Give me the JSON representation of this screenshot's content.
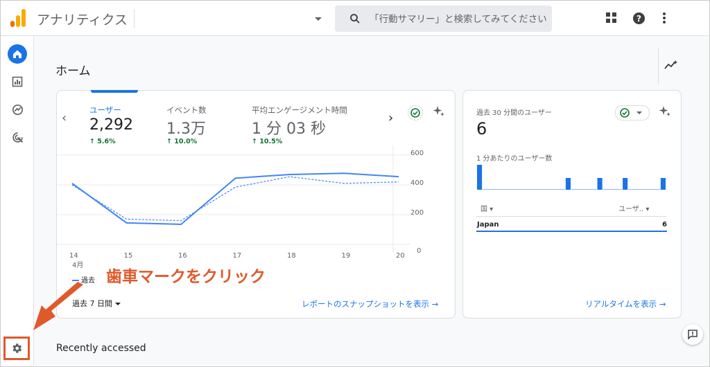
{
  "app": {
    "title": "アナリティクス"
  },
  "search": {
    "placeholder": "「行動サマリー」と検索してみてください"
  },
  "colors": {
    "accent": "#1a73e8",
    "annotation": "#e0592a",
    "positive": "#137333"
  },
  "icons": [
    "analytics-logo",
    "search-icon",
    "apps-grid-icon",
    "help-icon",
    "more-vert-icon",
    "home-icon",
    "reports-icon",
    "explore-icon",
    "advertising-icon",
    "gear-icon",
    "insights-icon",
    "check-circle-icon",
    "sparkle-icon",
    "feedback-icon"
  ],
  "page": {
    "title": "ホーム",
    "recent": "Recently accessed"
  },
  "metrics": [
    {
      "label": "ユーザー",
      "value": "2,292",
      "change": "↑ 5.6%"
    },
    {
      "label": "イベント数",
      "value": "1.3万",
      "change": "↑ 10.0%"
    },
    {
      "label": "平均エンゲージメント時間",
      "value": "1 分 03 秒",
      "change": "↑ 10.5%"
    }
  ],
  "chart_data": {
    "type": "line",
    "x": [
      "14",
      "15",
      "16",
      "17",
      "18",
      "19",
      "20"
    ],
    "x_sublabel": "4月",
    "y_ticks": [
      "600",
      "400",
      "200",
      "0"
    ],
    "ylim": [
      0,
      600
    ],
    "series": [
      {
        "name": "過去",
        "style": "solid",
        "color": "#4285f4",
        "values": [
          410,
          145,
          135,
          445,
          470,
          478,
          455
        ]
      },
      {
        "style": "dashed",
        "color": "#4285f4",
        "values": [
          400,
          170,
          160,
          385,
          455,
          410,
          420
        ]
      }
    ],
    "legend": "bottom-left"
  },
  "date_range": {
    "label": "過去 7 日間"
  },
  "main_link": "レポートのスナップショットを表示 →",
  "annotation": "歯車マークをクリック",
  "realtime": {
    "title": "過去 30 分間のユーザー",
    "value": "6",
    "per_minute_label": "1 分あたりのユーザー数",
    "bars": [
      1,
      0,
      0,
      0,
      0,
      0,
      0,
      0,
      0,
      0,
      0,
      0,
      0,
      0,
      1,
      0,
      0,
      0,
      0,
      1,
      0,
      0,
      0,
      1,
      0,
      0,
      0,
      0,
      0,
      1
    ],
    "col_country": "国 ▾",
    "col_users": "ユーザ.. ▾",
    "rows": [
      {
        "country": "Japan",
        "users": "6"
      }
    ],
    "link": "リアルタイムを表示 →"
  }
}
